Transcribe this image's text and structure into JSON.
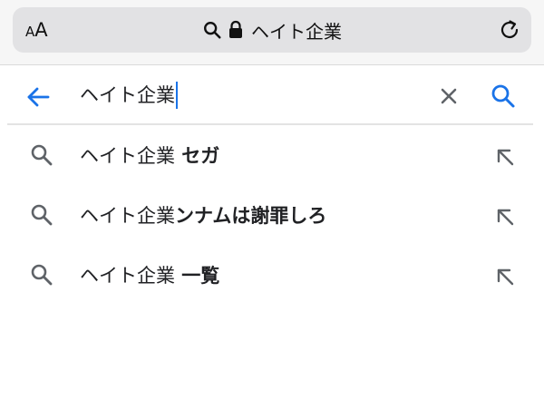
{
  "browser": {
    "text_size_small": "A",
    "text_size_large": "A",
    "url_text": "ヘイト企業"
  },
  "search": {
    "query": "ヘイト企業"
  },
  "suggestions": [
    {
      "prefix": "ヘイト企業",
      "bold": " セガ"
    },
    {
      "prefix": "ヘイト企業",
      "bold": "ンナムは謝罪しろ"
    },
    {
      "prefix": "ヘイト企業",
      "bold": " 一覧"
    }
  ],
  "colors": {
    "accent": "#1a73e8",
    "icon_gray": "#5f6368"
  }
}
